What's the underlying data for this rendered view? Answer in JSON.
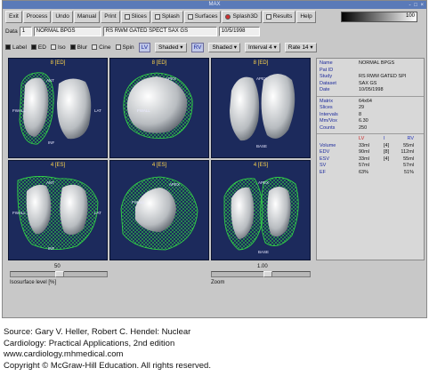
{
  "window": {
    "title": "MAX",
    "controls": "- □ ×"
  },
  "toolbar": {
    "buttons": [
      "Exit",
      "Process",
      "Undo",
      "Manual",
      "Print"
    ],
    "checks": [
      {
        "label": "Slices",
        "on": false,
        "kind": "box"
      },
      {
        "label": "Splash",
        "on": false,
        "kind": "box"
      },
      {
        "label": "Surfaces",
        "on": false,
        "kind": "box"
      },
      {
        "label": "Splash3D",
        "on": true,
        "kind": "radio"
      },
      {
        "label": "Results",
        "on": false,
        "kind": "box"
      }
    ],
    "help": "Help",
    "grayscale_value": "100"
  },
  "data_row": {
    "label": "Data",
    "index": "1",
    "patient": "NORMAL BPGS",
    "study": "RS RWM GATED SPECT SAX GS",
    "date": "10/5/1998"
  },
  "options_row": {
    "label": "Label",
    "ed": "ED",
    "iso": "Iso",
    "blur": "Blur",
    "cine": "Cine",
    "spin": "Spin",
    "lv": "LV",
    "lv_mode": "Shaded",
    "rv": "RV",
    "rv_mode": "Shaded",
    "interval": "Interval  4",
    "rate": "Rate 14"
  },
  "panels": [
    {
      "title": "8 [ED]",
      "labels": [
        "ANT",
        "FWALL",
        "LAT",
        "INF"
      ]
    },
    {
      "title": "8 [ED]",
      "labels": [
        "APEX",
        "FWALL"
      ]
    },
    {
      "title": "8 [ED]",
      "labels": [
        "APEX",
        "BASE"
      ]
    },
    {
      "title": "4 [ES]",
      "labels": [
        "ANT",
        "FWALL",
        "LAT",
        "INF"
      ]
    },
    {
      "title": "4 [ES]",
      "labels": [
        "APEX",
        "FWALL"
      ]
    },
    {
      "title": "4 [ES]",
      "labels": [
        "APEX",
        "BASE"
      ]
    }
  ],
  "info": {
    "patient": [
      {
        "k": "Name",
        "v": "NORMAL BPGS"
      },
      {
        "k": "Pat ID",
        "v": ""
      },
      {
        "k": "Study",
        "v": "RS RWM GATED SPI"
      },
      {
        "k": "Dataset",
        "v": "SAX GS"
      },
      {
        "k": "Date",
        "v": "10/05/1998"
      }
    ],
    "acquisition": [
      {
        "k": "Matrix",
        "v": "64x64"
      },
      {
        "k": "Slices",
        "v": "29"
      },
      {
        "k": "Intervals",
        "v": "8"
      },
      {
        "k": "Mm/Vox",
        "v": "6.30"
      },
      {
        "k": "Counts",
        "v": "250"
      }
    ],
    "volumes_header": {
      "lv": "LV",
      "sep": "I",
      "rv": "RV"
    },
    "volumes": [
      {
        "k": "Volume",
        "lv": "33ml",
        "n": "[4]",
        "rv": "55ml"
      },
      {
        "k": "EDV",
        "lv": "90ml",
        "n": "[8]",
        "rv": "112ml"
      },
      {
        "k": "ESV",
        "lv": "33ml",
        "n": "[4]",
        "rv": "55ml"
      },
      {
        "k": "SV",
        "lv": "57ml",
        "n": "",
        "rv": "57ml"
      },
      {
        "k": "EF",
        "lv": "63%",
        "n": "",
        "rv": "51%"
      }
    ]
  },
  "sliders": {
    "iso_value": "50",
    "iso_label": "Isosurface level [%]",
    "zoom_value": "1.00",
    "zoom_label": "Zoom"
  },
  "source": {
    "line1": "Source: Gary V. Heller, Robert C. Hendel: Nuclear",
    "line2": "Cardiology: Practical Applications, 2nd edition",
    "line3": "www.cardiology.mhmedical.com",
    "line4": "Copyright © McGraw-Hill Education. All rights reserved."
  },
  "colors": {
    "panel_bg": "#1c2a5c",
    "mesh": "#33dd44",
    "title": "#ffd54a",
    "lv_header": "#cc2222",
    "rv_header": "#2233bb"
  }
}
